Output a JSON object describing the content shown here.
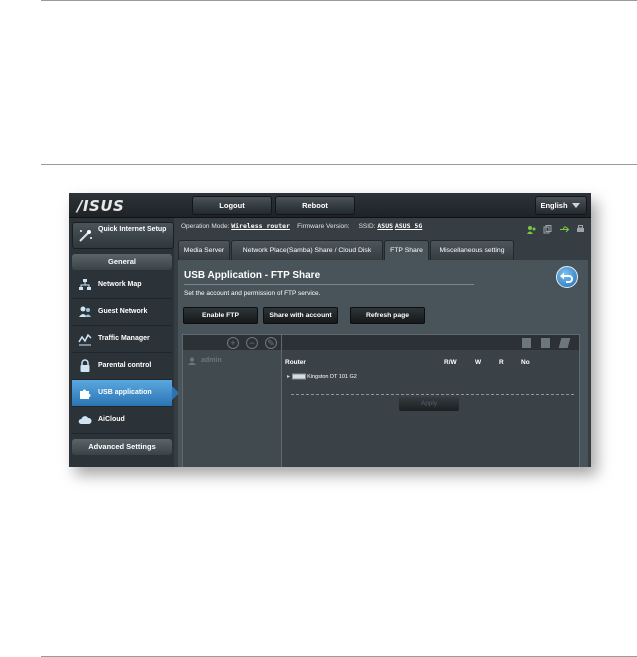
{
  "topbar": {
    "logo": "/ISUS",
    "logout": "Logout",
    "reboot": "Reboot",
    "language": "English"
  },
  "status": {
    "op_mode_label": "Operation Mode:",
    "op_mode_value": "Wireless router",
    "firmware_label": "Firmware Version:",
    "ssid_label": "SSID:",
    "ssid_1": "ASUS",
    "ssid_2": "ASUS_5G"
  },
  "sidebar": {
    "quick_setup": "Quick Internet Setup",
    "general_header": "General",
    "items": [
      {
        "label": "Network Map",
        "icon": "network-map-icon"
      },
      {
        "label": "Guest Network",
        "icon": "guest-network-icon"
      },
      {
        "label": "Traffic Manager",
        "icon": "traffic-manager-icon"
      },
      {
        "label": "Parental control",
        "icon": "lock-icon"
      },
      {
        "label": "USB application",
        "icon": "puzzle-icon",
        "active": true
      },
      {
        "label": "AiCloud",
        "icon": "cloud-icon"
      }
    ],
    "advanced_header": "Advanced Settings"
  },
  "tabs": [
    "Media Server",
    "Network Place(Samba) Share / Cloud Disk",
    "FTP Share",
    "Miscellaneous setting"
  ],
  "active_tab": "FTP Share",
  "panel": {
    "title": "USB Application - FTP Share",
    "description": "Set the account and permission of FTP service.",
    "buttons": [
      "Enable FTP",
      "Share with account",
      "Refresh page"
    ]
  },
  "table": {
    "account": "admin",
    "folder_root": "Router",
    "columns": [
      "R/W",
      "W",
      "R",
      "No"
    ],
    "device": "Kingston DT 101 G2",
    "apply": "Apply"
  },
  "colors": {
    "accent": "#2b74b3",
    "panel": "#49535a",
    "bg": "#363e43"
  }
}
